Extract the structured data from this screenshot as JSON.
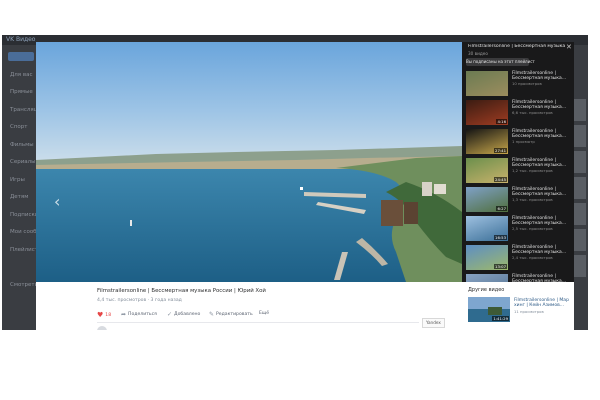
{
  "background": {
    "logo": "VK Видео",
    "sidebar_items": [
      "",
      "Для вас",
      "Прямые",
      "Трансляции",
      "Спорт",
      "Фильмы",
      "Сериалы",
      "Игры",
      "Детям",
      "Подписки",
      "Мои сообщества",
      "Плейлисты",
      "",
      "Смотреть"
    ]
  },
  "video": {
    "title": "Filmstrailersonline | Бессмертная музыка России | Юрий Хой",
    "meta": "4,4 тыс. просмотров · 3 года назад"
  },
  "actions": {
    "like_count": "18",
    "share": "Поделиться",
    "added": "Добавлено",
    "edit": "Редактировать",
    "more": "Ещё"
  },
  "yandex_badge": "Yandex",
  "playlist": {
    "title": "Filmstrailersonline | Бессмертная музыка Росс",
    "count": "30 видео",
    "subscribe_label": "Вы подписаны на этот плейлист",
    "close_icon": "close-icon",
    "items": [
      {
        "name": "Filmstrailersonline | Бессмертная музыка...",
        "views": "10 просмотров",
        "duration": "",
        "c1": "#6b7b52",
        "c2": "#9c8d5e"
      },
      {
        "name": "Filmstrailersonline | Бессмертная музыка...",
        "views": "6,6 тыс. просмотров",
        "duration": "4:16",
        "c1": "#3b1c12",
        "c2": "#a03c22"
      },
      {
        "name": "Filmstrailersonline | Бессмертная музыка...",
        "views": "1 просмотр",
        "duration": "27:41",
        "c1": "#141414",
        "c2": "#c7a64a"
      },
      {
        "name": "Filmstrailersonline | Бессмертная музыка...",
        "views": "1,2 тыс. просмотров",
        "duration": "24:45",
        "c1": "#6b8f4c",
        "c2": "#c9b26b"
      },
      {
        "name": "Filmstrailersonline | Бессмертная музыка...",
        "views": "1,3 тыс. просмотров",
        "duration": "6:27",
        "c1": "#7fa1c8",
        "c2": "#506f3d"
      },
      {
        "name": "Filmstrailersonline | Бессмертная музыка...",
        "views": "2,5 тыс. просмотров",
        "duration": "16:53",
        "c1": "#9ec0e0",
        "c2": "#3b6f97"
      },
      {
        "name": "Filmstrailersonline | Бессмертная музыка...",
        "views": "2,4 тыс. просмотров",
        "duration": "13:07",
        "c1": "#5d8ec4",
        "c2": "#9db86b"
      },
      {
        "name": "Filmstrailersonline | Бессмертная музыка...",
        "views": "",
        "duration": "",
        "c1": "#87a2c2",
        "c2": "#4f6f8d"
      }
    ]
  },
  "other_videos": {
    "title": "Другие видео",
    "item": {
      "name": "Filmstrailersonline | Мар хинг | Кейн Азимов...",
      "views": "11 просмотров",
      "duration": "1:41:29"
    }
  }
}
